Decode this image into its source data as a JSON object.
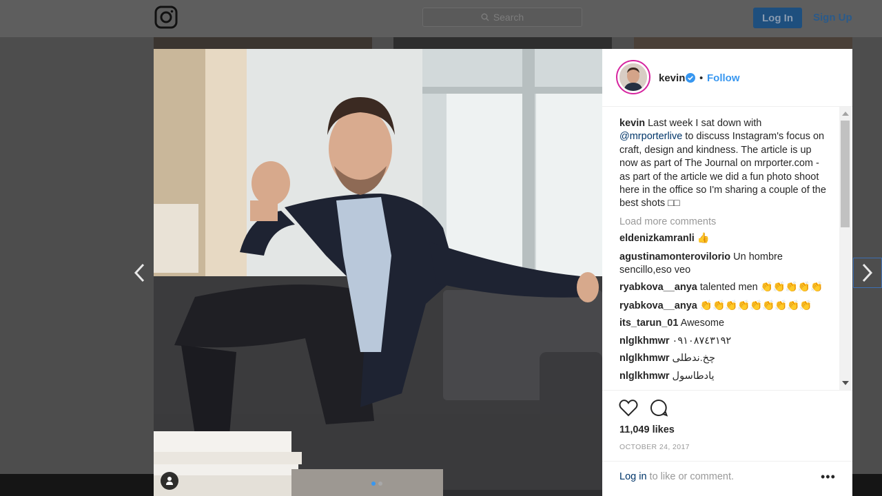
{
  "topbar": {
    "search_placeholder": "Search",
    "login_label": "Log In",
    "signup_label": "Sign Up"
  },
  "post": {
    "username": "kevin",
    "verified": true,
    "follow_label": "Follow",
    "caption_user": "kevin",
    "caption_before": " Last week I sat down with ",
    "caption_mention": "@mrporterlive",
    "caption_after": " to discuss Instagram's focus on craft, design and kindness. The article is up now as part of The Journal on mrporter.com - as part of the article we did a fun photo shoot here in the office so I'm sharing a couple of the best shots □□",
    "load_more": "Load more comments",
    "comments": [
      {
        "user": "eldenizkamranli",
        "text": " 👍"
      },
      {
        "user": "agustinamonterovilorio",
        "text": " Un hombre sencillo,eso veo"
      },
      {
        "user": "ryabkova__anya",
        "text": " talented men 👏👏👏👏👏"
      },
      {
        "user": "ryabkova__anya",
        "text": " 👏👏👏👏👏👏👏👏👏"
      },
      {
        "user": "its_tarun_01",
        "text": " Awesome"
      },
      {
        "user": "nlglkhmwr",
        "text": " ٠٩١٠٨٧٤٣١٩٢"
      },
      {
        "user": "nlglkhmwr",
        "text": " چخ.ندطلی"
      },
      {
        "user": "nlglkhmwr",
        "text": " یادطاسول"
      }
    ],
    "likes": "11,049 likes",
    "date": "OCTOBER 24, 2017",
    "login_link": "Log in",
    "login_suffix": " to like or comment.",
    "more_options": "•••",
    "carousel": {
      "count": 2,
      "active": 1
    }
  },
  "colors": {
    "link_blue": "#3897f0",
    "mention_dark_blue": "#003569",
    "muted_gray": "#999999"
  },
  "icons": [
    "instagram-logo-icon",
    "search-icon",
    "verified-badge-icon",
    "chevron-left-icon",
    "chevron-right-icon",
    "heart-icon",
    "comment-icon",
    "user-tag-icon"
  ]
}
